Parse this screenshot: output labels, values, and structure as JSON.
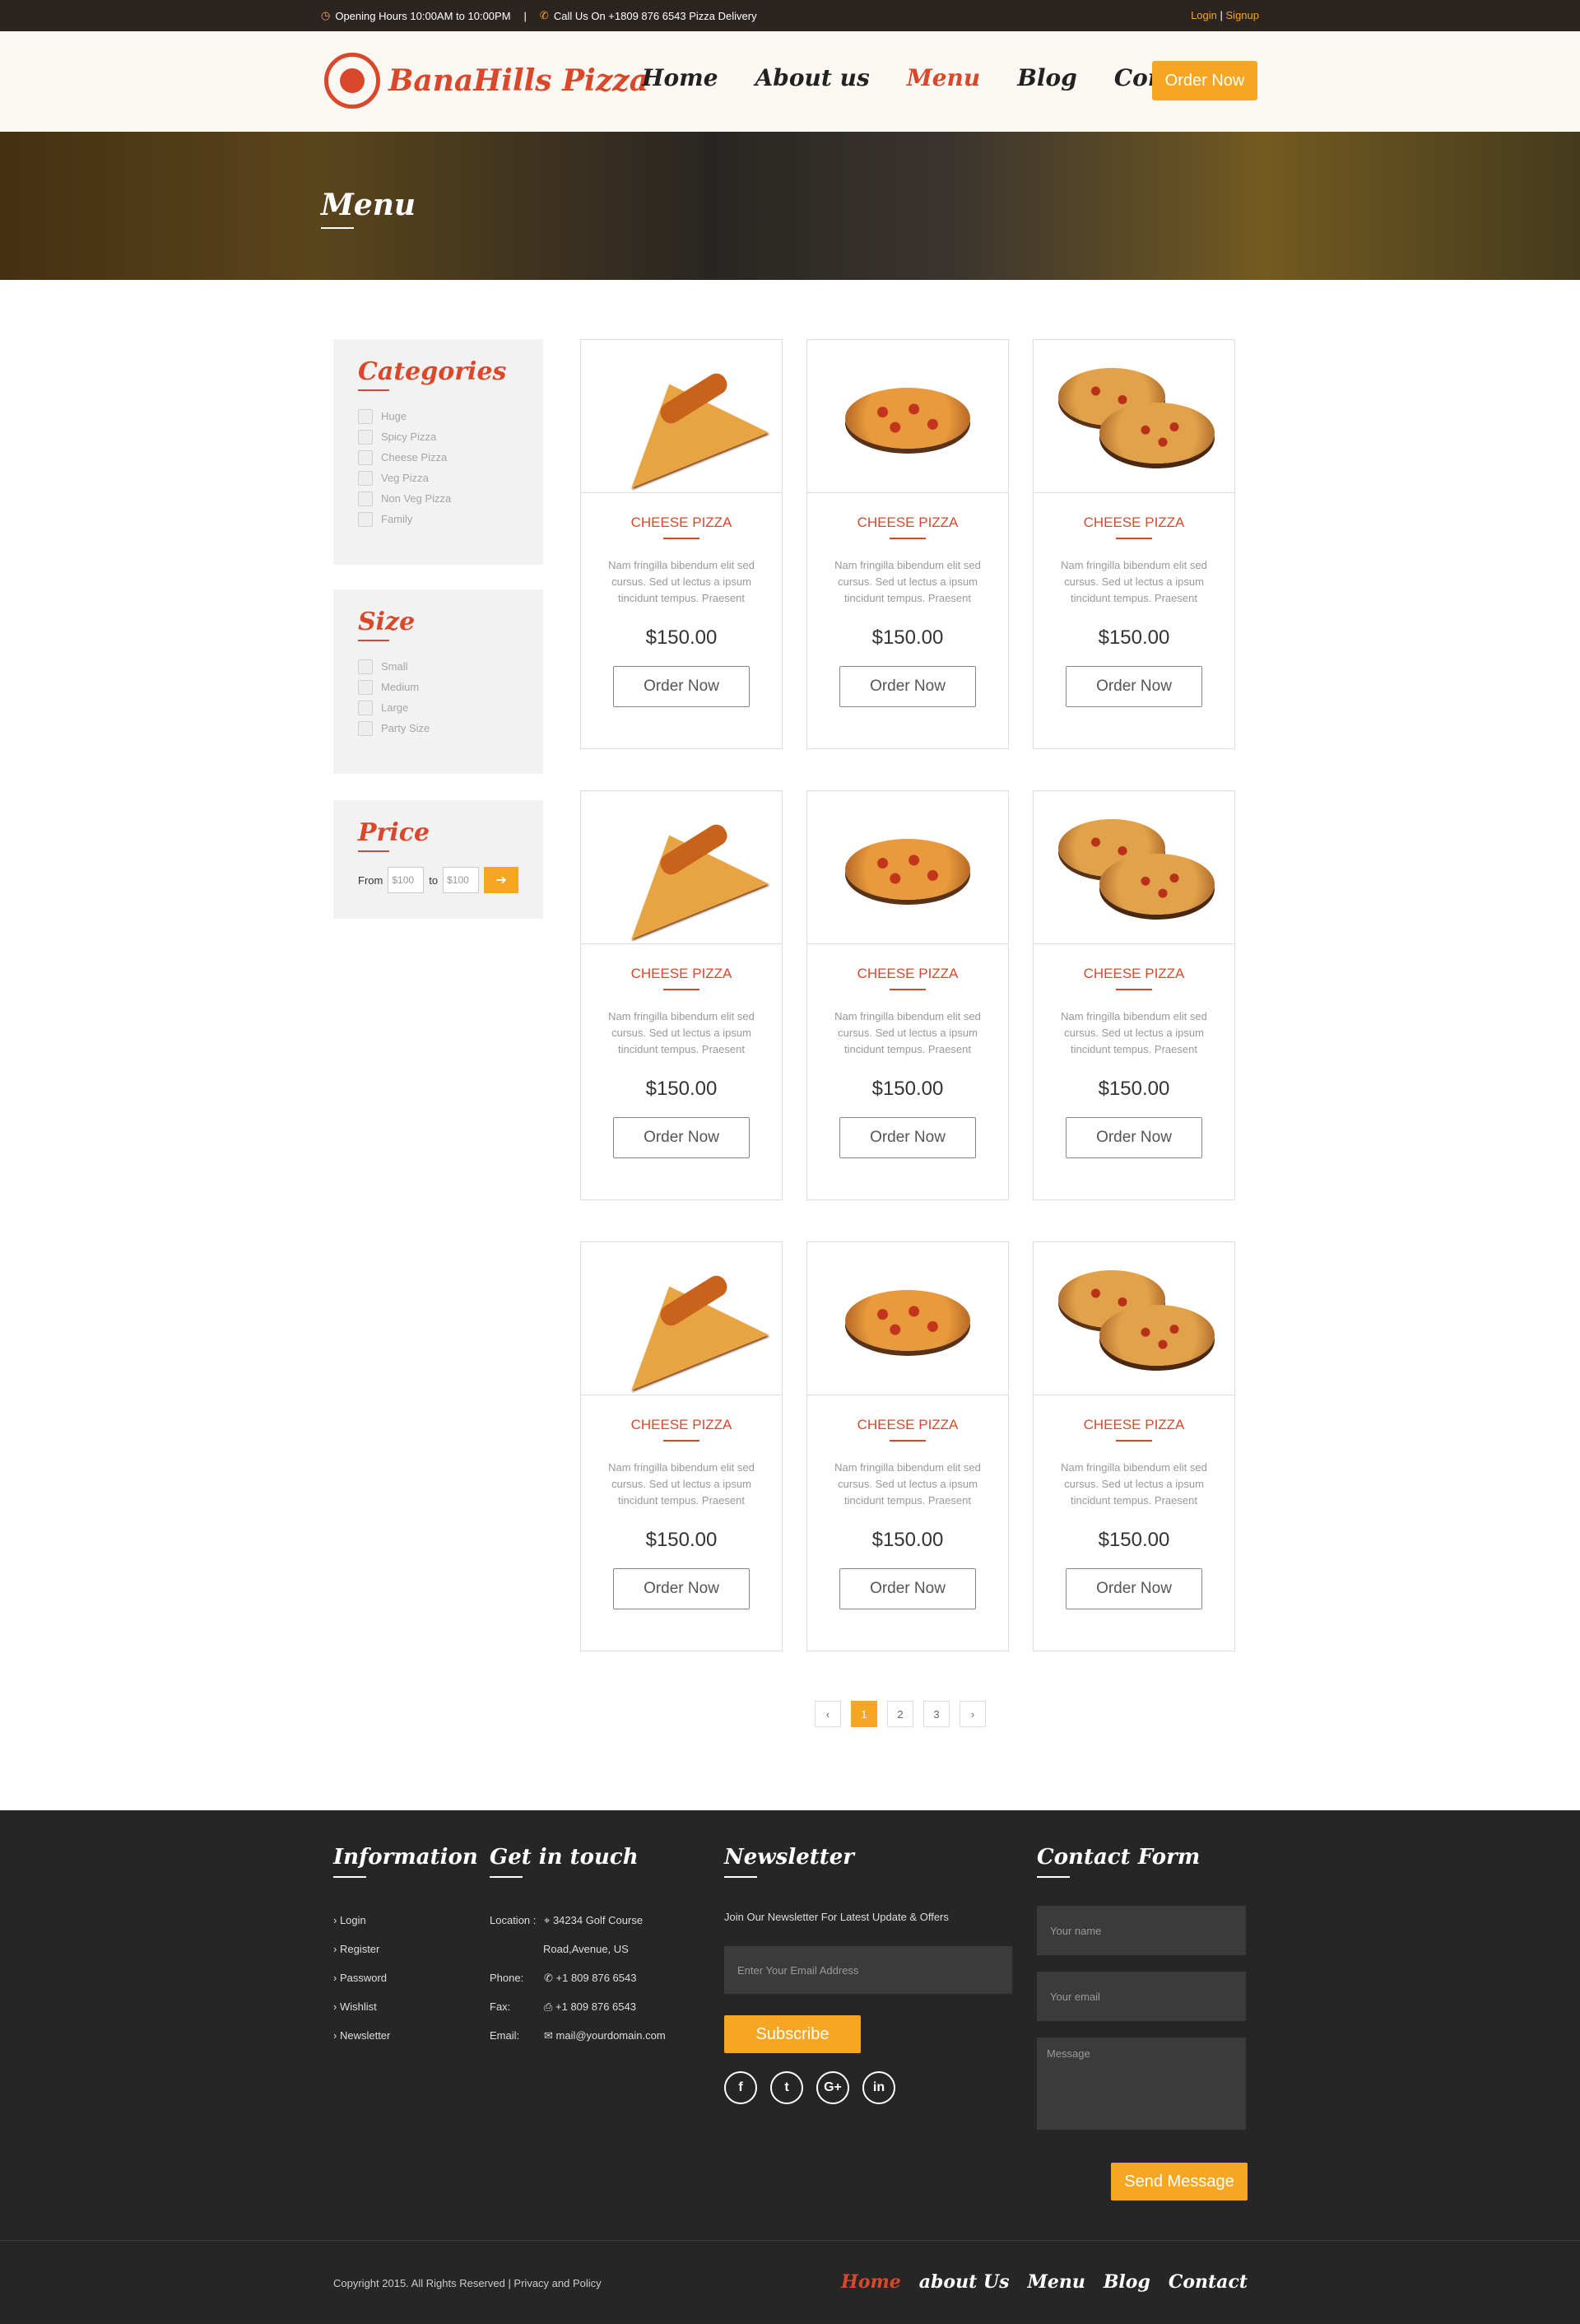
{
  "topbar": {
    "hours": "Opening Hours 10:00AM to 10:00PM",
    "separator": "|",
    "call": "Call Us On +1809 876 6543 Pizza Delivery",
    "login": "Login",
    "divider": "|",
    "signup": "Signup"
  },
  "header": {
    "logo_text": "BanaHills Pizza",
    "nav": [
      "Home",
      "About us",
      "Menu",
      "Blog",
      "Contact"
    ],
    "order_label": "Order Now"
  },
  "banner": {
    "title": "Menu"
  },
  "sidebar": {
    "categories": {
      "title": "Categories",
      "items": [
        "Huge",
        "Spicy Pizza",
        "Cheese Pizza",
        "Veg Pizza",
        "Non Veg Pizza",
        "Family"
      ]
    },
    "size": {
      "title": "Size",
      "items": [
        "Small",
        "Medium",
        "Large",
        "Party Size"
      ]
    },
    "price": {
      "title": "Price",
      "from_label": "From",
      "from_value": "$100",
      "to_label": "to",
      "to_value": "$100",
      "go_symbol": "➔"
    }
  },
  "products": [
    {
      "name": "CHEESE PIZZA",
      "desc": "Nam fringilla bibendum elit sed cursus. Sed ut lectus a ipsum tincidunt tempus. Praesent",
      "price": "$150.00",
      "button": "Order Now",
      "image": "pizza-slice"
    },
    {
      "name": "CHEESE PIZZA",
      "desc": "Nam fringilla bibendum elit sed cursus. Sed ut lectus a ipsum tincidunt tempus. Praesent",
      "price": "$150.00",
      "button": "Order Now",
      "image": "pepperoni-pizza"
    },
    {
      "name": "CHEESE PIZZA",
      "desc": "Nam fringilla bibendum elit sed cursus. Sed ut lectus a ipsum tincidunt tempus. Praesent",
      "price": "$150.00",
      "button": "Order Now",
      "image": "two-pizzas"
    },
    {
      "name": "CHEESE PIZZA",
      "desc": "Nam fringilla bibendum elit sed cursus. Sed ut lectus a ipsum tincidunt tempus. Praesent",
      "price": "$150.00",
      "button": "Order Now",
      "image": "pizza-slice"
    },
    {
      "name": "CHEESE PIZZA",
      "desc": "Nam fringilla bibendum elit sed cursus. Sed ut lectus a ipsum tincidunt tempus. Praesent",
      "price": "$150.00",
      "button": "Order Now",
      "image": "pepperoni-pizza"
    },
    {
      "name": "CHEESE PIZZA",
      "desc": "Nam fringilla bibendum elit sed cursus. Sed ut lectus a ipsum tincidunt tempus. Praesent",
      "price": "$150.00",
      "button": "Order Now",
      "image": "two-pizzas"
    },
    {
      "name": "CHEESE PIZZA",
      "desc": "Nam fringilla bibendum elit sed cursus. Sed ut lectus a ipsum tincidunt tempus. Praesent",
      "price": "$150.00",
      "button": "Order Now",
      "image": "pizza-slice"
    },
    {
      "name": "CHEESE PIZZA",
      "desc": "Nam fringilla bibendum elit sed cursus. Sed ut lectus a ipsum tincidunt tempus. Praesent",
      "price": "$150.00",
      "button": "Order Now",
      "image": "pepperoni-pizza"
    },
    {
      "name": "CHEESE PIZZA",
      "desc": "Nam fringilla bibendum elit sed cursus. Sed ut lectus a ipsum tincidunt tempus. Praesent",
      "price": "$150.00",
      "button": "Order Now",
      "image": "two-pizzas"
    }
  ],
  "pagination": {
    "prev": "‹",
    "pages": [
      "1",
      "2",
      "3"
    ],
    "active": "1",
    "next": "›"
  },
  "footer": {
    "information": {
      "title": "Information",
      "links": [
        "Login",
        "Register",
        "Password",
        "Wishlist",
        "Newsletter"
      ]
    },
    "contact": {
      "title": "Get in touch",
      "location_label": "Location :",
      "location_value": "34234 Golf Course",
      "location_value2": "Road,Avenue, US",
      "phone_label": "Phone:",
      "phone_value": "+1 809 876 6543",
      "fax_label": "Fax:",
      "fax_value": "+1 809 876 6543",
      "email_label": "Email:",
      "email_value": "mail@yourdomain.com"
    },
    "newsletter": {
      "title": "Newsletter",
      "text": "Join Our Newsletter For Latest Update & Offers",
      "placeholder": "Enter Your Email Address",
      "button": "Subscribe",
      "socials": [
        "f",
        "t",
        "G+",
        "in"
      ]
    },
    "contact_form": {
      "title": "Contact Form",
      "name_placeholder": "Your name",
      "email_placeholder": "Your email",
      "message_placeholder": "Message",
      "button": "Send Message"
    },
    "copyright": "Copyright 2015. All Rights Reserved | Privacy and Policy",
    "nav": [
      "Home",
      "about Us",
      "Menu",
      "Blog",
      "Contact"
    ]
  },
  "colors": {
    "accent": "#f5a623",
    "brand": "#d9482b",
    "dark": "#262626"
  }
}
